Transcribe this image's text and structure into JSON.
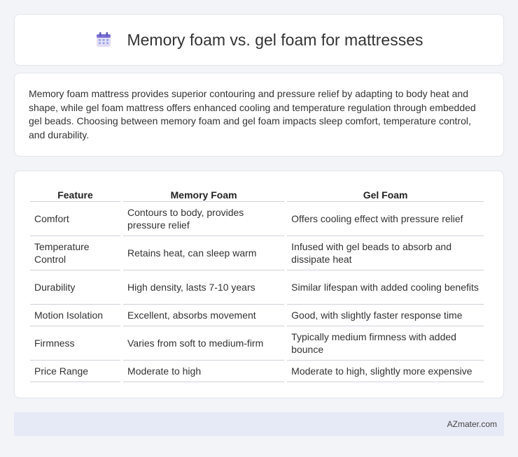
{
  "header": {
    "title": "Memory foam vs. gel foam for mattresses",
    "icon": "calendar-icon"
  },
  "intro": {
    "text": "Memory foam mattress provides superior contouring and pressure relief by adapting to body heat and shape, while gel foam mattress offers enhanced cooling and temperature regulation through embedded gel beads. Choosing between memory foam and gel foam impacts sleep comfort, temperature control, and durability."
  },
  "table": {
    "headers": [
      "Feature",
      "Memory Foam",
      "Gel Foam"
    ],
    "rows": [
      [
        "Comfort",
        "Contours to body, provides pressure relief",
        "Offers cooling effect with pressure relief"
      ],
      [
        "Temperature Control",
        "Retains heat, can sleep warm",
        "Infused with gel beads to absorb and dissipate heat"
      ],
      [
        "Durability",
        "High density, lasts 7-10 years",
        "Similar lifespan with added cooling benefits"
      ],
      [
        "Motion Isolation",
        "Excellent, absorbs movement",
        "Good, with slightly faster response time"
      ],
      [
        "Firmness",
        "Varies from soft to medium-firm",
        "Typically medium firmness with added bounce"
      ],
      [
        "Price Range",
        "Moderate to high",
        "Moderate to high, slightly more expensive"
      ]
    ]
  },
  "footer": {
    "source": "AZmater.com"
  }
}
